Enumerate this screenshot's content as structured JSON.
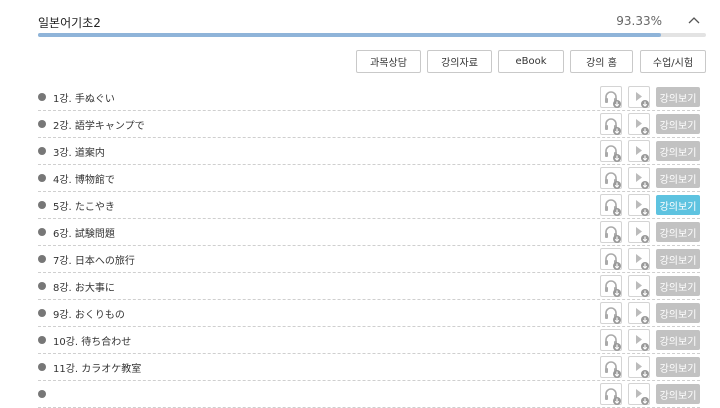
{
  "course": {
    "title": "일본어기초2",
    "progress_text": "93.33%",
    "progress_value": 0.9333
  },
  "toolbar": {
    "buttons": [
      "과목상담",
      "강의자료",
      "eBook",
      "강의 홈",
      "수업/시험"
    ]
  },
  "lessons": [
    {
      "title": "1강. 手ぬぐい",
      "watch": "강의보기",
      "active": false
    },
    {
      "title": "2강. 語学キャンプで",
      "watch": "강의보기",
      "active": false
    },
    {
      "title": "3강. 道案内",
      "watch": "강의보기",
      "active": false
    },
    {
      "title": "4강. 博物館で",
      "watch": "강의보기",
      "active": false
    },
    {
      "title": "5강. たこやき",
      "watch": "강의보기",
      "active": true
    },
    {
      "title": "6강. 試験問題",
      "watch": "강의보기",
      "active": false
    },
    {
      "title": "7강. 日本への旅行",
      "watch": "강의보기",
      "active": false
    },
    {
      "title": "8강. お大事に",
      "watch": "강의보기",
      "active": false
    },
    {
      "title": "9강. おくりもの",
      "watch": "강의보기",
      "active": false
    },
    {
      "title": "10강. 待ち合わせ",
      "watch": "강의보기",
      "active": false
    },
    {
      "title": "11강. カラオケ教室",
      "watch": "강의보기",
      "active": false
    },
    {
      "title": "",
      "watch": "강의보기",
      "active": false
    }
  ],
  "icons": {
    "collapse": "chevron-up-icon",
    "audio": "headphones-download-icon",
    "video": "play-download-icon"
  },
  "colors": {
    "progress": "#8fb4d9",
    "active_watch": "#5ec3e0",
    "inactive_watch": "#c2c2c2"
  }
}
